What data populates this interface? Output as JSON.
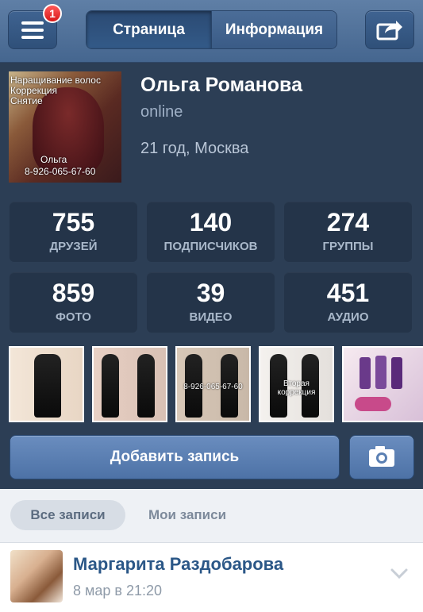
{
  "navbar": {
    "menu_badge": "1",
    "tabs": [
      {
        "label": "Страница",
        "active": true
      },
      {
        "label": "Информация",
        "active": false
      }
    ]
  },
  "profile": {
    "name": "Ольга Романова",
    "status": "online",
    "details": "21 год, Москва",
    "avatar_text": {
      "line1": "Наращивание волос",
      "line2": "Коррекция",
      "line3": "Снятие",
      "line4": "Ольга",
      "line5": "8-926-065-67-60"
    }
  },
  "stats": [
    {
      "value": "755",
      "label": "ДРУЗЕЙ"
    },
    {
      "value": "140",
      "label": "ПОДПИСЧИКОВ"
    },
    {
      "value": "274",
      "label": "ГРУППЫ"
    },
    {
      "value": "859",
      "label": "ФОТО"
    },
    {
      "value": "39",
      "label": "ВИДЕО"
    },
    {
      "value": "451",
      "label": "АУДИО"
    }
  ],
  "photos": {
    "photo3_text": "8-926-065-67-60",
    "photo4_text": "Вторая коррекция"
  },
  "actions": {
    "add_post_label": "Добавить запись"
  },
  "feed": {
    "filters": [
      "Все записи",
      "Мои записи"
    ],
    "post": {
      "author": "Маргарита Раздобарова",
      "time": "8 мар в 21:20"
    }
  },
  "colors": {
    "navbar": "#4f719b",
    "background": "#2c3e55",
    "tile": "#243449",
    "accent": "#5b80b3",
    "link": "#2b5787",
    "badge": "#e82828"
  },
  "icons": [
    "menu-icon",
    "share-icon",
    "camera-icon",
    "chevron-down-icon"
  ]
}
